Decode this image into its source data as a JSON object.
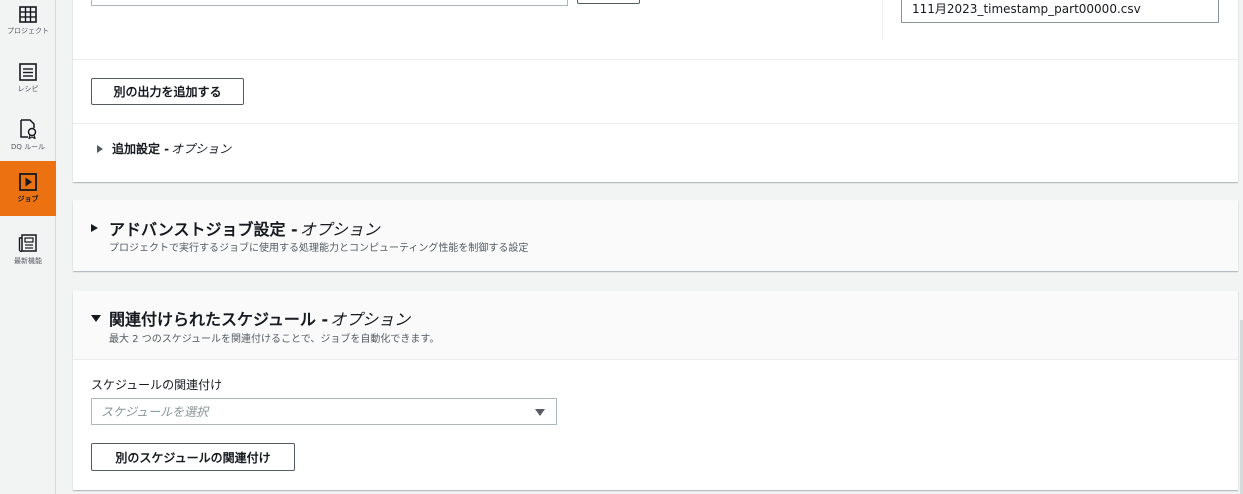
{
  "sidebar": {
    "items": [
      {
        "label": "プロジェクト",
        "icon": "grid-icon"
      },
      {
        "label": "レシピ",
        "icon": "list-icon"
      },
      {
        "label": "DQ ルール",
        "icon": "document-badge-icon"
      },
      {
        "label": "ジョブ",
        "icon": "play-icon",
        "active": true
      },
      {
        "label": "最新機能",
        "icon": "newspaper-icon"
      }
    ],
    "active_color": "#ec7211"
  },
  "output_card": {
    "file_name_value": "111月2023_timestamp_part00000.csv",
    "add_output_label": "別の出力を追加する",
    "additional_settings_label": "追加設定 - ",
    "additional_settings_optional": "オプション"
  },
  "advanced_job": {
    "title": "アドバンストジョブ設定 -",
    "optional": "オプション",
    "description": "プロジェクトで実行するジョブに使用する処理能力とコンピューティング性能を制御する設定"
  },
  "schedules": {
    "title": "関連付けられたスケジュール -",
    "optional": "オプション",
    "description": "最大 2 つのスケジュールを関連付けることで、ジョブを自動化できます。",
    "field_label": "スケジュールの関連付け",
    "select_placeholder": "スケジュールを選択",
    "add_schedule_label": "別のスケジュールの関連付け"
  }
}
